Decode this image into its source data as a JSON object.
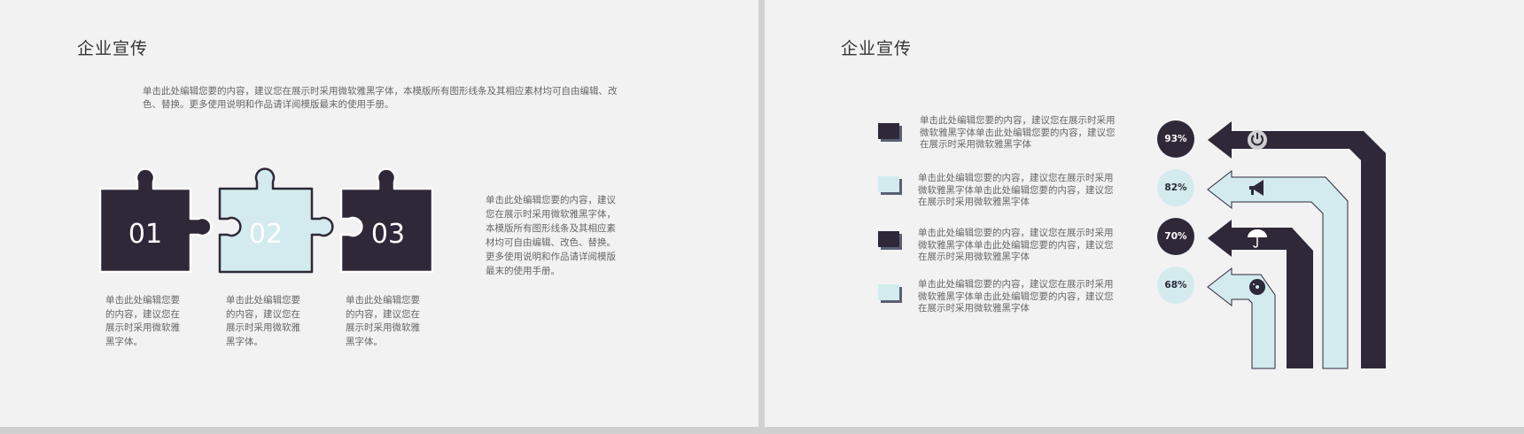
{
  "left_slide": {
    "title": "企业宣传",
    "intro": "单击此处编辑您要的内容，建议您在展示时采用微软雅黑字体，本模版所有图形线条及其相应素材均可自由编辑、改色、替换。更多使用说明和作品请详阅模版最末的使用手册。",
    "pieces": [
      {
        "number": "01",
        "caption": "单击此处编辑您要的内容，建议您在展示时采用微软雅黑字体。",
        "style": "dark"
      },
      {
        "number": "02",
        "caption": "单击此处编辑您要的内容，建议您在展示时采用微软雅黑字体。",
        "style": "light"
      },
      {
        "number": "03",
        "caption": "单击此处编辑您要的内容，建议您在展示时采用微软雅黑字体。",
        "style": "dark"
      }
    ],
    "side_text": "单击此处编辑您要的内容，建议您在展示时采用微软雅黑字体，本模版所有图形线条及其相应素材均可自由编辑、改色、替换。更多使用说明和作品请详阅模版最末的使用手册。"
  },
  "right_slide": {
    "title": "企业宣传",
    "rows": [
      {
        "text": "单击此处编辑您要的内容，建议您在展示时采用微软雅黑字体单击此处编辑您要的内容，建议您在展示时采用微软雅黑字体",
        "style": "dark",
        "percent": "93%",
        "icon": "power-icon"
      },
      {
        "text": "单击此处编辑您要的内容，建议您在展示时采用微软雅黑字体单击此处编辑您要的内容，建议您在展示时采用微软雅黑字体",
        "style": "light",
        "percent": "82%",
        "icon": "megaphone-icon"
      },
      {
        "text": "单击此处编辑您要的内容，建议您在展示时采用微软雅黑字体单击此处编辑您要的内容，建议您在展示时采用微软雅黑字体",
        "style": "dark",
        "percent": "70%",
        "icon": "umbrella-icon"
      },
      {
        "text": "单击此处编辑您要的内容，建议您在展示时采用微软雅黑字体单击此处编辑您要的内容，建议您在展示时采用微软雅黑字体",
        "style": "light",
        "percent": "68%",
        "icon": "disc-icon"
      }
    ]
  },
  "colors": {
    "dark": "#2e2838",
    "light": "#d3ebee",
    "background": "#f2f2f3",
    "text": "#666666"
  }
}
